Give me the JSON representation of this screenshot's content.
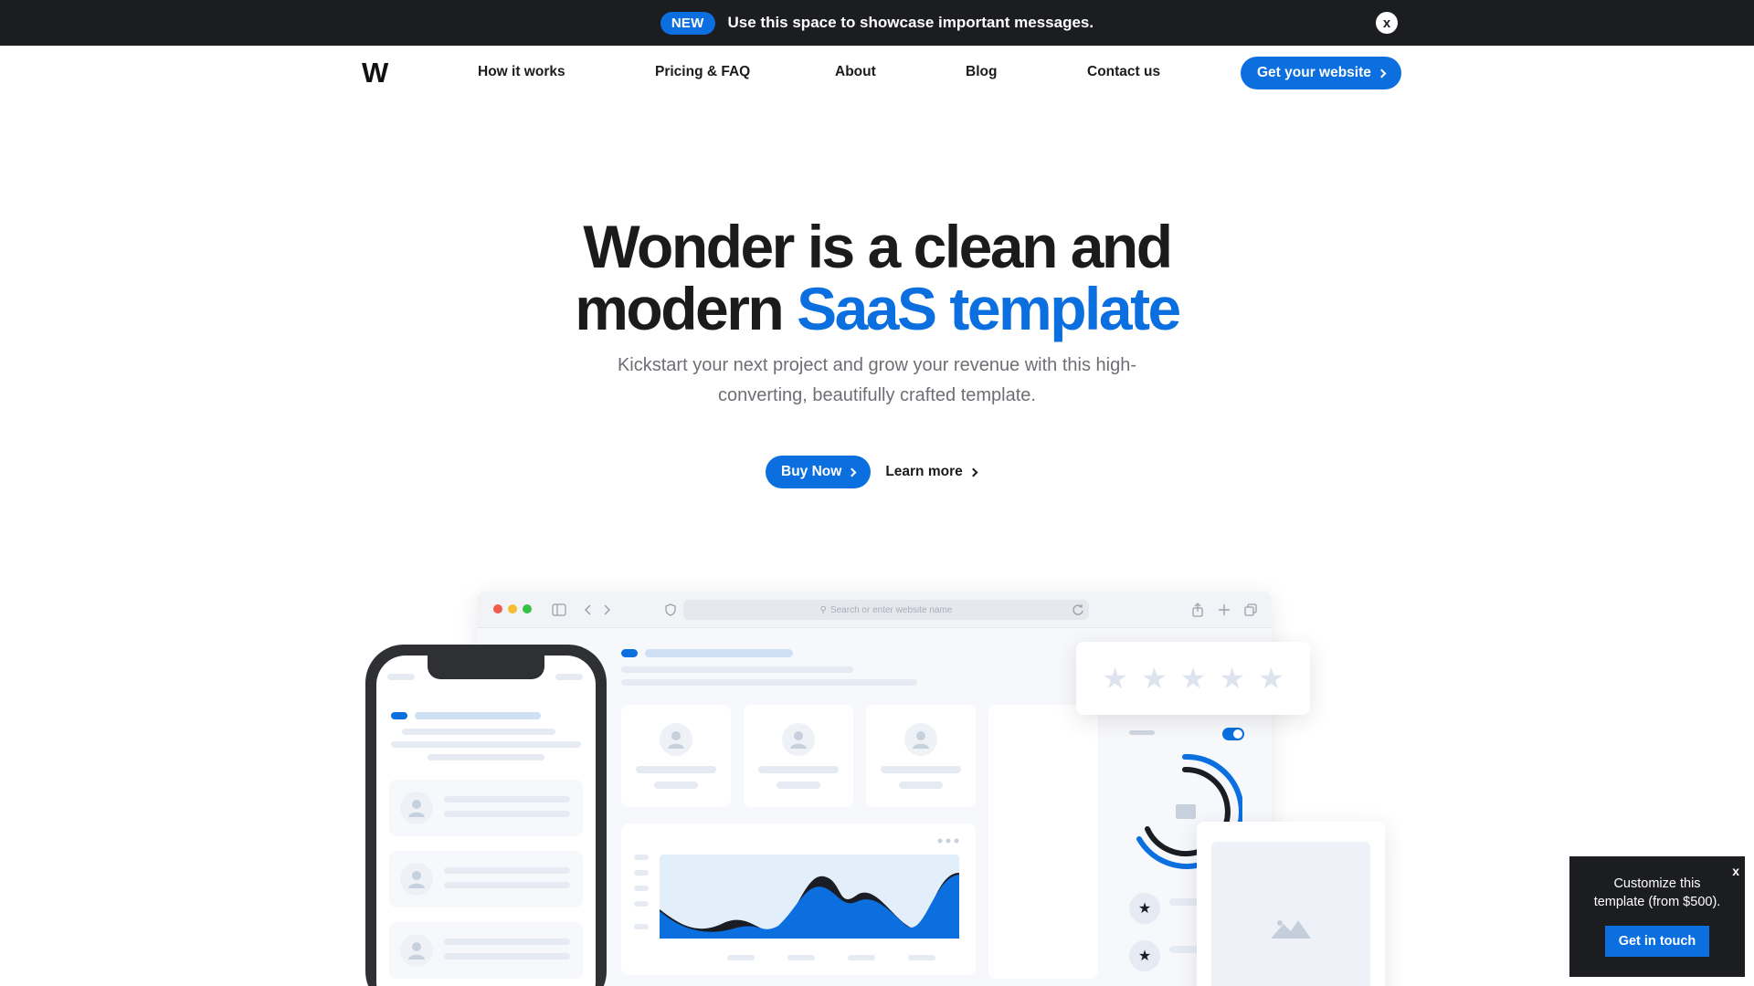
{
  "announcement": {
    "badge": "NEW",
    "message": "Use this space to showcase important messages.",
    "close_label": "x"
  },
  "nav": {
    "logo": "W",
    "links": [
      "How it works",
      "Pricing & FAQ",
      "About",
      "Blog",
      "Contact us"
    ],
    "cta": "Get your website"
  },
  "hero": {
    "title_line1": "Wonder is a clean and",
    "title_line2_plain": "modern ",
    "title_line2_accent": "SaaS template",
    "subtitle_line1": "Kickstart your next project and grow your revenue with this high-",
    "subtitle_line2": "converting, beautifully crafted template.",
    "primary_cta": "Buy Now",
    "secondary_cta": "Learn more"
  },
  "mockup": {
    "url_placeholder": "Search or enter website name",
    "rating_stars": 5
  },
  "popup": {
    "close_label": "x",
    "text_line1": "Customize this",
    "text_line2": "template (from $500).",
    "button": "Get in touch"
  },
  "colors": {
    "accent": "#0b6fdf",
    "dark": "#1c1d21"
  }
}
